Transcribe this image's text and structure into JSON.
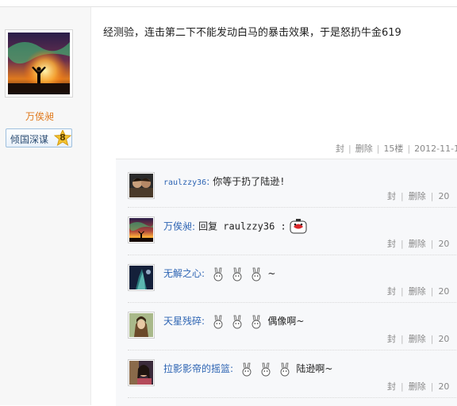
{
  "user": {
    "name": "万俟昶",
    "badge": {
      "label": "倾国深谋",
      "level": "8"
    }
  },
  "post": {
    "text": "经测验，连击第二下不能发动白马的暴击效果，于是怒扔牛金619",
    "actions": {
      "block": "封",
      "delete": "删除",
      "floor": "15楼",
      "date": "2012-11-1"
    }
  },
  "replies": [
    {
      "name": "raulzzy36",
      "content": "你等于扔了陆逊!",
      "emoticons": 0
    },
    {
      "name": "万俟昶",
      "content": "回复 raulzzy36 :",
      "emoticons": 0
    },
    {
      "name": "无解之心",
      "content": "~",
      "emoticons": 3
    },
    {
      "name": "天星残碎",
      "content": "偶像啊~",
      "emoticons": 3
    },
    {
      "name": "拉影影帝的摇篮",
      "content": "陆逊啊~",
      "emoticons": 3
    }
  ],
  "reply_actions": {
    "block": "封",
    "delete": "删除",
    "date": "20"
  }
}
